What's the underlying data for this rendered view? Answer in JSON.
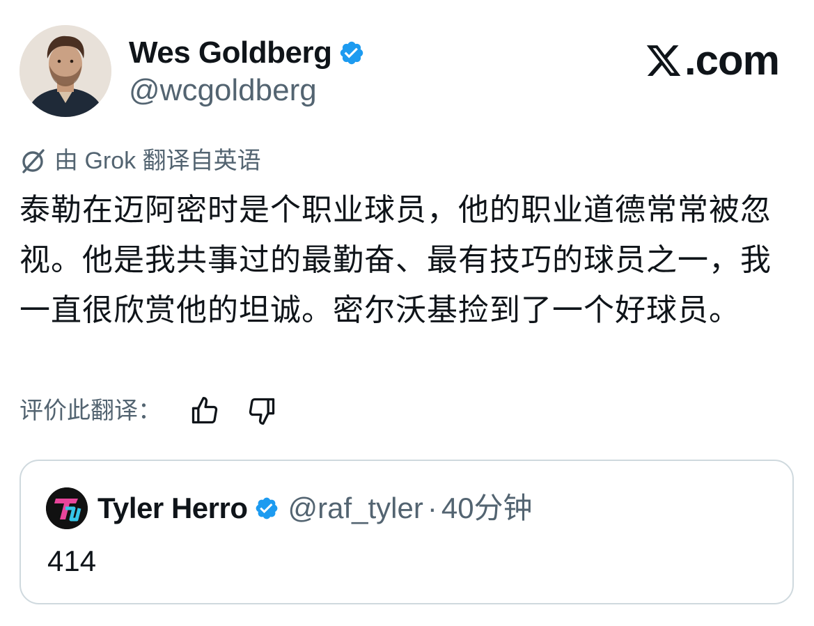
{
  "author": {
    "display_name": "Wes Goldberg",
    "handle": "@wcgoldberg",
    "verified": true,
    "avatar": "author-photo"
  },
  "brand": {
    "text": ".com",
    "icon": "x-logo-icon"
  },
  "translation": {
    "icon": "grok-icon",
    "label": "由 Grok 翻译自英语"
  },
  "tweet": {
    "text": "泰勒在迈阿密时是个职业球员，他的职业道德常常被忽视。他是我共事过的最勤奋、最有技巧的球员之一，我一直很欣赏他的坦诚。密尔沃基捡到了一个好球员。"
  },
  "rate": {
    "label": "评价此翻译：",
    "thumbs_up_icon": "thumbs-up-icon",
    "thumbs_down_icon": "thumbs-down-icon"
  },
  "quote": {
    "display_name": "Tyler Herro",
    "handle": "@raf_tyler",
    "separator": "·",
    "time": "40分钟",
    "verified": true,
    "avatar_icon": "tyler-herro-logo-icon",
    "text": "414"
  },
  "colors": {
    "verified_blue": "#1d9bf0",
    "text_primary": "#0f1419",
    "text_secondary": "#536471",
    "border": "#cfd9de"
  }
}
